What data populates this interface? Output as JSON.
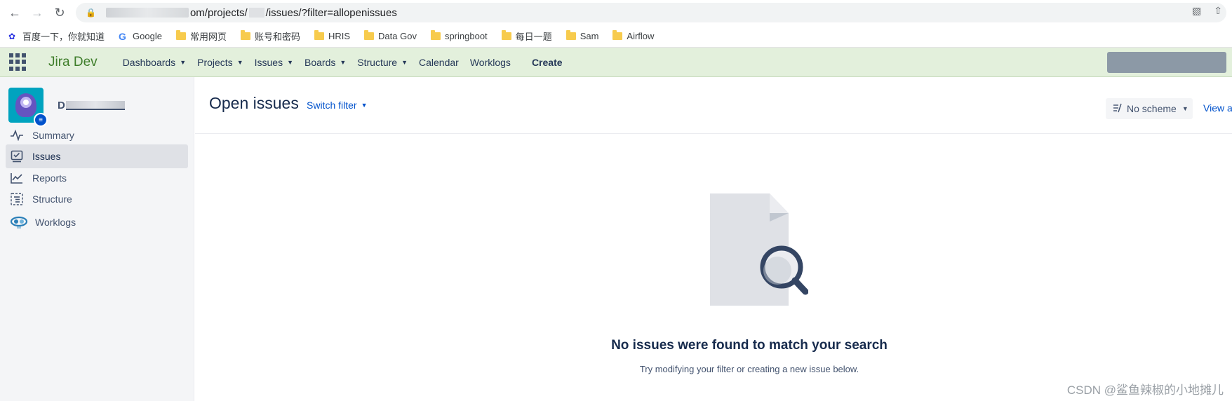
{
  "browser": {
    "url_visible": "om/projects/",
    "url_path": "/issues/?filter=allopenissues",
    "url_prefix": "jira.dev"
  },
  "bookmarks": [
    {
      "label": "百度一下，你就知道",
      "icon": "baidu-icon"
    },
    {
      "label": "Google",
      "icon": "google-icon"
    },
    {
      "label": "常用网页",
      "icon": "folder-icon"
    },
    {
      "label": "账号和密码",
      "icon": "folder-icon"
    },
    {
      "label": "HRIS",
      "icon": "folder-icon"
    },
    {
      "label": "Data Gov",
      "icon": "folder-icon"
    },
    {
      "label": "springboot",
      "icon": "folder-icon"
    },
    {
      "label": "每日一题",
      "icon": "folder-icon"
    },
    {
      "label": "Sam",
      "icon": "folder-icon"
    },
    {
      "label": "Airflow",
      "icon": "folder-icon"
    }
  ],
  "jira_nav": {
    "logo": "Jira Dev",
    "items": [
      {
        "label": "Dashboards",
        "dropdown": true
      },
      {
        "label": "Projects",
        "dropdown": true
      },
      {
        "label": "Issues",
        "dropdown": true
      },
      {
        "label": "Boards",
        "dropdown": true
      },
      {
        "label": "Structure",
        "dropdown": true
      },
      {
        "label": "Calendar",
        "dropdown": false
      },
      {
        "label": "Worklogs",
        "dropdown": false
      }
    ],
    "create_label": "Create"
  },
  "sidebar": {
    "project_initial": "D",
    "items": [
      {
        "label": "Summary",
        "icon": "pulse-icon",
        "active": false
      },
      {
        "label": "Issues",
        "icon": "issues-icon",
        "active": true
      },
      {
        "label": "Reports",
        "icon": "chart-icon",
        "active": false
      },
      {
        "label": "Structure",
        "icon": "structure-icon",
        "active": false
      },
      {
        "label": "Worklogs",
        "icon": "worklogs-icon",
        "active": false
      }
    ]
  },
  "main": {
    "title": "Open issues",
    "switch_filter": "Switch filter",
    "scheme_label": "No scheme",
    "view_all": "View a",
    "empty_title": "No issues were found to match your search",
    "empty_subtitle": "Try modifying your filter or creating a new issue below."
  },
  "watermark": "CSDN @鲨鱼辣椒的小地摊儿",
  "colors": {
    "nav_bg": "#e3f0dc",
    "logo": "#3e7d2a",
    "link": "#0052cc",
    "sidebar_bg": "#f4f5f7",
    "active_item": "#dfe1e6"
  }
}
